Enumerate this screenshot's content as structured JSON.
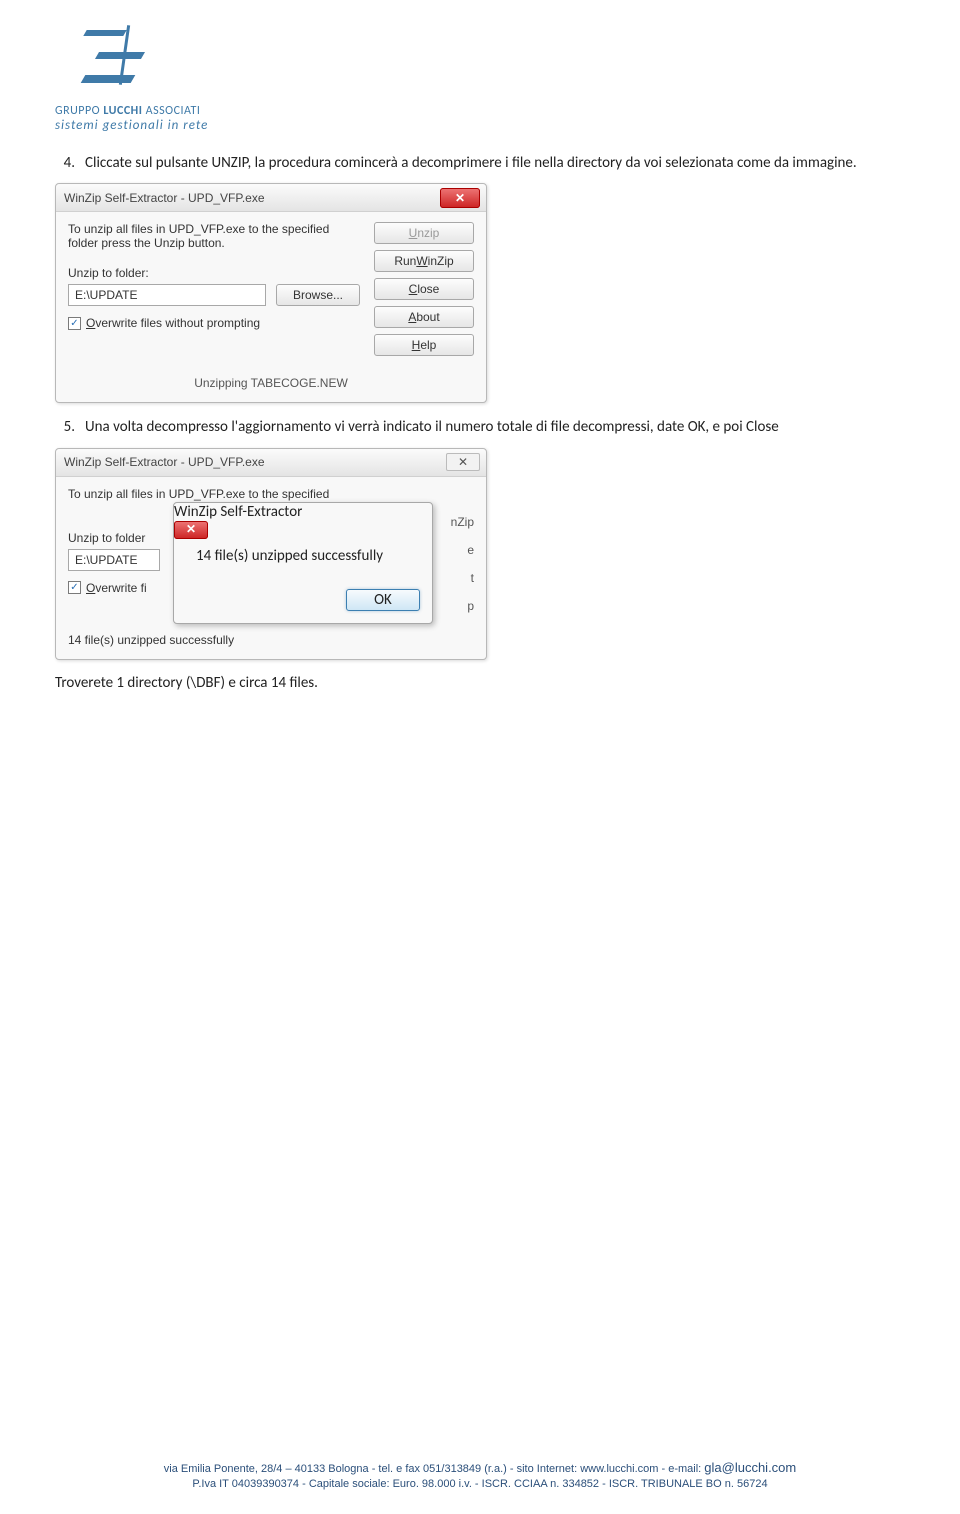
{
  "logo": {
    "line1_a": "GRUPPO",
    "line1_b": "LUCCHI",
    "line1_c": "ASSOCIATI",
    "line2": "sistemi gestionali in rete"
  },
  "step4": {
    "num": "4.",
    "text": "Cliccate sul pulsante UNZIP, la procedura comincerà a decomprimere i file nella directory da voi selezionata come da immagine."
  },
  "win1": {
    "title": "WinZip Self-Extractor - UPD_VFP.exe",
    "instr": "To unzip all files in UPD_VFP.exe to the specified folder press the Unzip button.",
    "unzip_to_label": "Unzip to folder:",
    "path": "E:\\UPDATE",
    "browse": "Browse...",
    "overwrite_pre": "O",
    "overwrite_rest": "verwrite files without prompting",
    "btn_unzip_pre": "U",
    "btn_unzip_rest": "nzip",
    "btn_runwinzip_pre": "Run ",
    "btn_runwinzip_u": "W",
    "btn_runwinzip_rest": "inZip",
    "btn_close_pre": "C",
    "btn_close_rest": "lose",
    "btn_about_pre": "A",
    "btn_about_rest": "bout",
    "btn_help_pre": "H",
    "btn_help_rest": "elp",
    "status": "Unzipping TABECOGE.NEW"
  },
  "step5": {
    "num": "5.",
    "text": "Una volta decompresso l'aggiornamento vi verrà indicato il numero totale di file decompressi, date OK, e poi Close"
  },
  "win2": {
    "title": "WinZip Self-Extractor - UPD_VFP.exe",
    "instr": "To unzip all files in UPD_VFP.exe to the specified",
    "unzip_to_label": "Unzip to folder",
    "path": "E:\\UPDATE",
    "overwrite_pre": "O",
    "overwrite_rest": "verwrite fi",
    "tail_nzip": "nZip",
    "tail_e": "e",
    "tail_t": "t",
    "tail_p": "p",
    "status": "14 file(s) unzipped successfully"
  },
  "modal": {
    "title": "WinZip Self-Extractor",
    "msg": "14 file(s) unzipped successfully",
    "ok": "OK"
  },
  "after": "Troverete 1 directory (\\DBF) e circa 14 files.",
  "footer": {
    "line1": "via Emilia Ponente, 28/4 – 40133 Bologna - tel. e fax 051/313849 (r.a.) - sito Internet: www.lucchi.com - e-mail: ",
    "mail": "gla@lucchi.com",
    "line2": "P.Iva IT 04039390374 - Capitale sociale: Euro. 98.000 i.v. - ISCR. CCIAA n. 334852 - ISCR. TRIBUNALE BO n. 56724"
  }
}
